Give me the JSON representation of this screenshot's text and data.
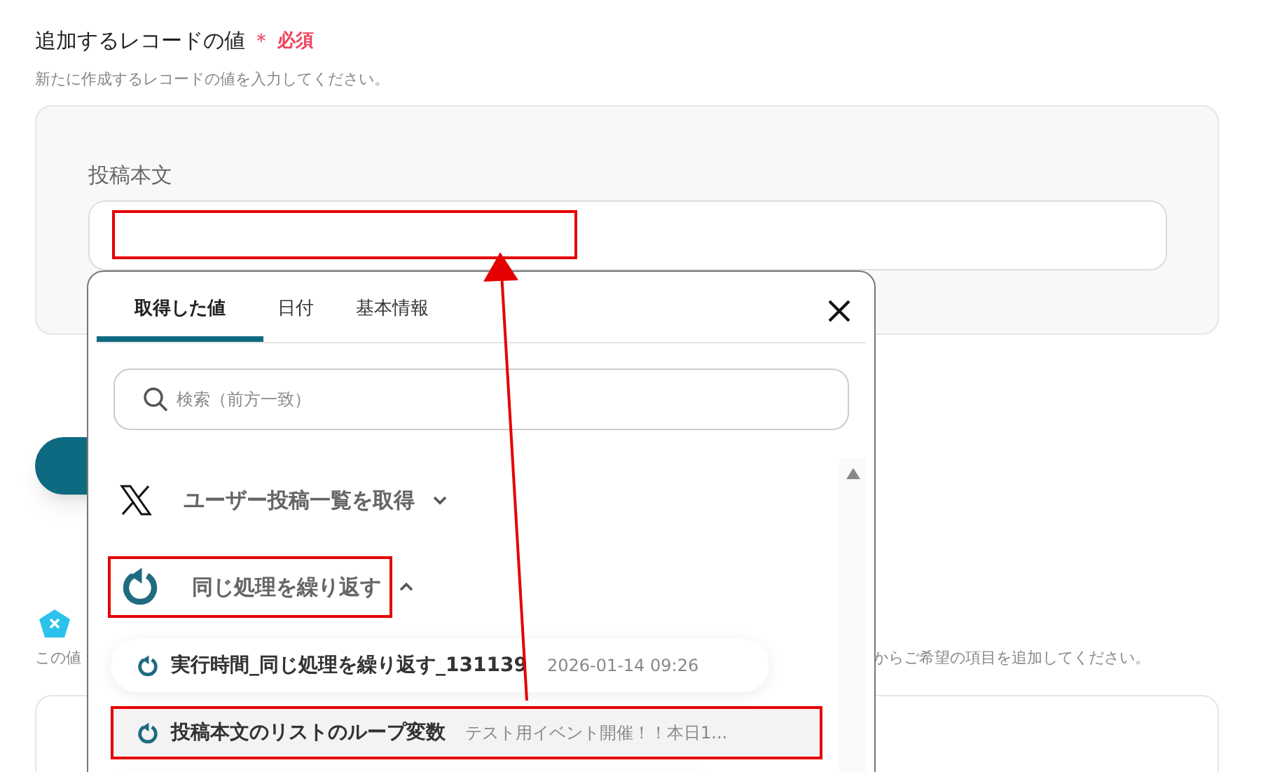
{
  "section": {
    "title": "追加するレコードの値",
    "required_mark": "＊",
    "required_label": "必須",
    "description": "新たに作成するレコードの値を入力してください。",
    "field": {
      "label": "投稿本文"
    }
  },
  "help_text": {
    "left": "この値",
    "right": "からご希望の項目を追加してください。"
  },
  "picker": {
    "tabs": [
      {
        "label": "取得した値",
        "selected": true
      },
      {
        "label": "日付",
        "selected": false
      },
      {
        "label": "基本情報",
        "selected": false
      }
    ],
    "search": {
      "placeholder": "検索（前方一致）"
    },
    "groups": [
      {
        "kind": "x",
        "title": "ユーザー投稿一覧を取得",
        "expanded": false
      },
      {
        "kind": "loop",
        "title": "同じ処理を繰り返す",
        "expanded": true,
        "items": [
          {
            "name": "実行時間_同じ処理を繰り返す_131139",
            "value": "2026-01-14 09:26",
            "selected": false
          },
          {
            "name": "投稿本文のリストのループ変数",
            "value": "テスト用イベント開催！！本日1...",
            "selected": true
          }
        ]
      }
    ]
  }
}
